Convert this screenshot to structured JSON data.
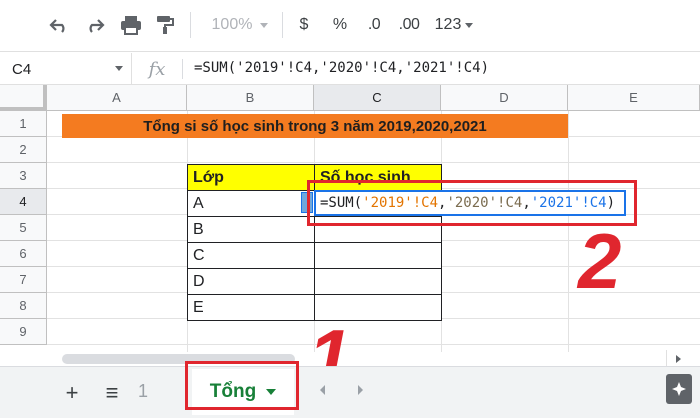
{
  "toolbar": {
    "undo_icon": "undo-icon",
    "redo_icon": "redo-icon",
    "print_icon": "print-icon",
    "paint_format_icon": "paint-format-icon",
    "zoom": "100%",
    "currency": "$",
    "percent": "%",
    "decrease_decimal": ".0",
    "increase_decimal": ".00",
    "more_formats": "123"
  },
  "formula_bar": {
    "name_box": "C4",
    "fx_label": "fx",
    "formula": "=SUM('2019'!C4,'2020'!C4,'2021'!C4)"
  },
  "grid": {
    "columns": [
      "A",
      "B",
      "C",
      "D",
      "E"
    ],
    "rows": [
      "1",
      "2",
      "3",
      "4",
      "5",
      "6",
      "7",
      "8",
      "9"
    ],
    "active_column": "C",
    "active_row": "4",
    "title": "Tổng si số học sinh trong 3 năm 2019,2020,2021",
    "title_color": "#f47b20",
    "table": {
      "header_lop": "Lớp",
      "header_so": "Số học sinh",
      "header_color": "#ffff00",
      "classes": [
        "A",
        "B",
        "C",
        "D",
        "E"
      ]
    },
    "edit_cell": {
      "prefix": "=SUM(",
      "ref1": "'2019'!C4",
      "sep1": ",",
      "ref2": "'2020'!C4",
      "sep2": ",",
      "ref3": "'2021'!C4",
      "suffix": ")"
    }
  },
  "annotations": {
    "step_1": "1",
    "step_2": "2",
    "highlight_color": "#e0262e"
  },
  "sheet_bar": {
    "add_sheet": "+",
    "all_sheets": "≡",
    "partial_tab": "1",
    "active_tab": "Tổng"
  }
}
